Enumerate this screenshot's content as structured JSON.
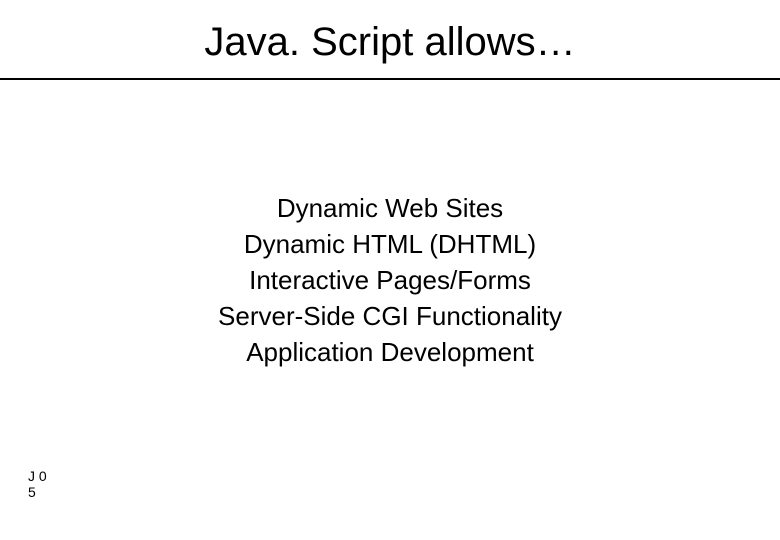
{
  "title": "Java. Script allows…",
  "body": {
    "lines": [
      "Dynamic Web Sites",
      "Dynamic HTML (DHTML)",
      "Interactive Pages/Forms",
      "Server-Side CGI Functionality",
      "Application Development"
    ]
  },
  "footer": {
    "line1": "J 0",
    "line2": "5"
  }
}
